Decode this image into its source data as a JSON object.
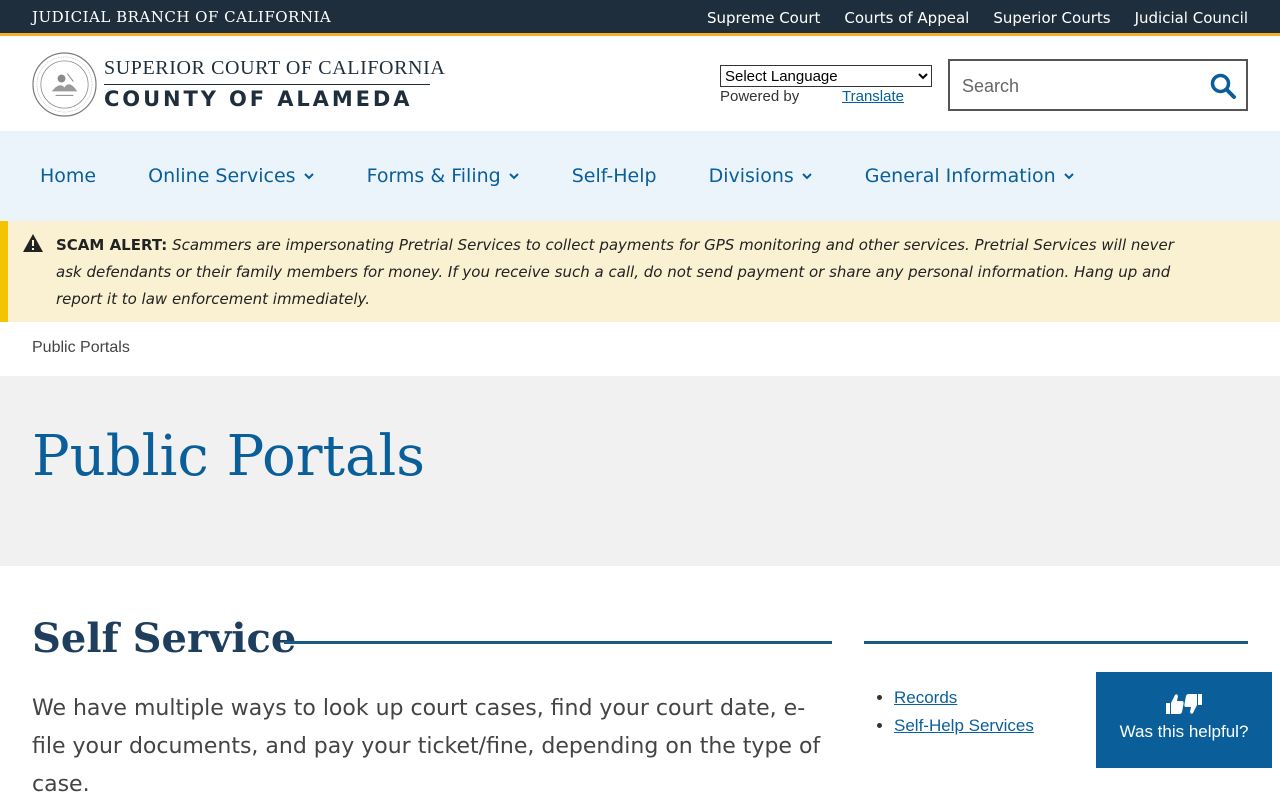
{
  "topbar": {
    "branch": "JUDICIAL BRANCH OF CALIFORNIA",
    "links": [
      "Supreme Court",
      "Courts of Appeal",
      "Superior Courts",
      "Judicial Council"
    ]
  },
  "header": {
    "court_line1": "SUPERIOR COURT OF CALIFORNIA",
    "court_line2": "COUNTY OF ALAMEDA",
    "language_select": "Select Language",
    "powered_by": "Powered by",
    "translate_link": "Translate",
    "search_placeholder": "Search"
  },
  "nav": {
    "items": [
      {
        "label": "Home",
        "dropdown": false
      },
      {
        "label": "Online Services",
        "dropdown": true
      },
      {
        "label": "Forms & Filing",
        "dropdown": true
      },
      {
        "label": "Self-Help",
        "dropdown": false
      },
      {
        "label": "Divisions",
        "dropdown": true
      },
      {
        "label": "General Information",
        "dropdown": true
      }
    ]
  },
  "alert": {
    "label": "SCAM ALERT:",
    "message": "Scammers are impersonating Pretrial Services to collect payments for GPS monitoring and other services.  Pretrial Services will never ask defendants or their family members for money. If you receive such a call, do not send payment or share any personal information.  Hang up and report it to law enforcement immediately."
  },
  "breadcrumb": "Public Portals",
  "page_title": "Public Portals",
  "content": {
    "section_title": "Self Service",
    "intro": "We have multiple ways to look up court cases, find your court date, e-file your documents, and pay your ticket/fine, depending on the type of case.",
    "side_links": [
      "Records",
      "Self-Help Services"
    ]
  },
  "feedback": {
    "label": "Was this helpful?"
  },
  "colors": {
    "topbar": "#1f2e3c",
    "accent_gold": "#f2b12c",
    "brand_blue": "#0a5f9a",
    "nav_bg": "#ebf3fb",
    "alert_bg": "#f9f1d2"
  }
}
